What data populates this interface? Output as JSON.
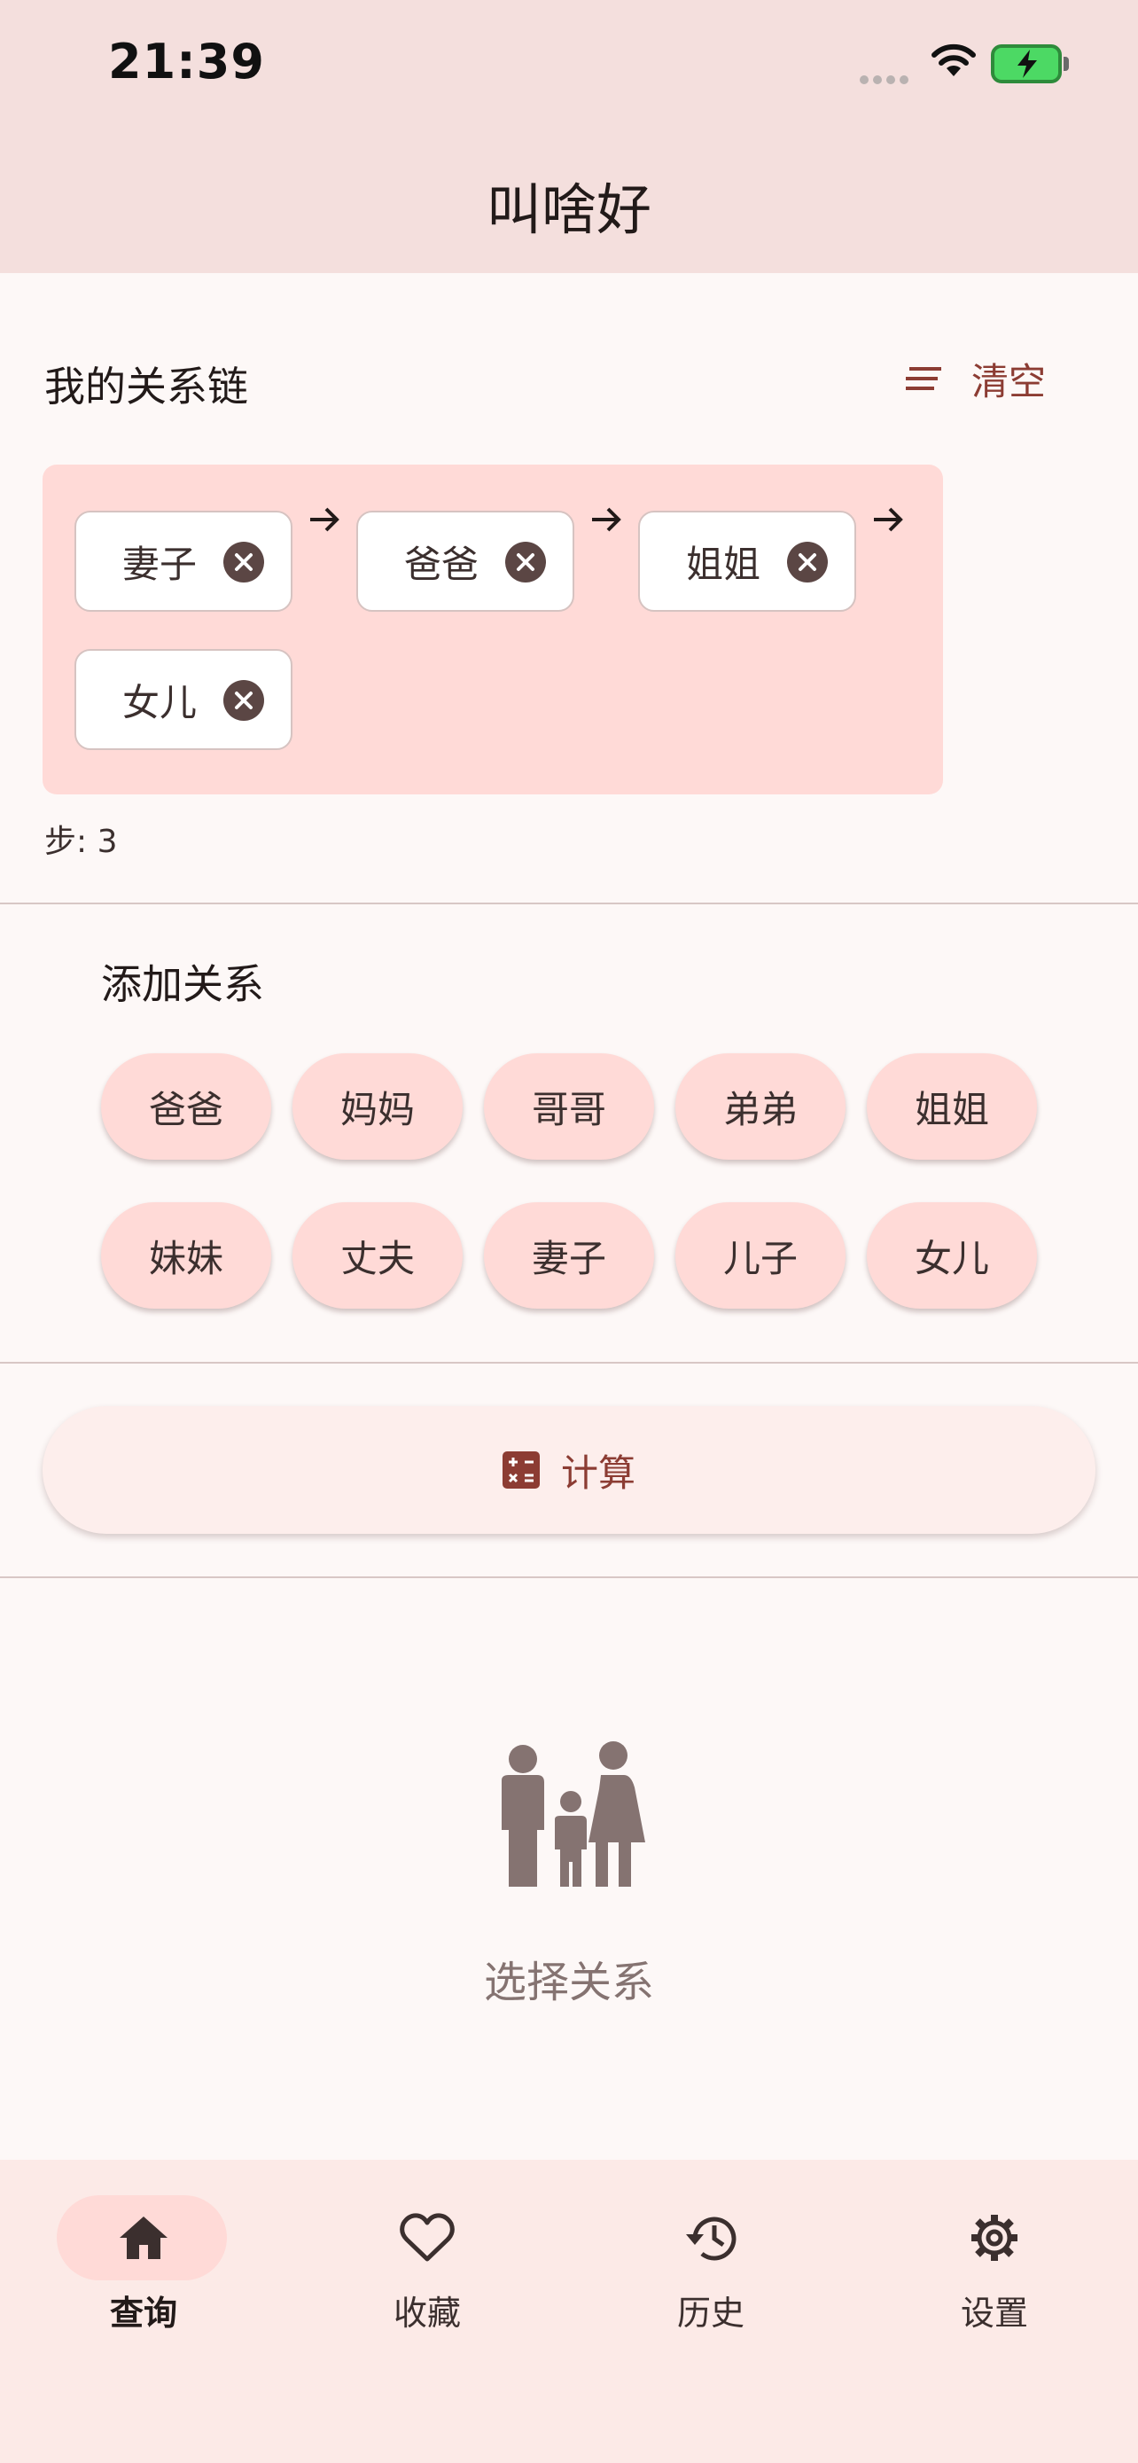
{
  "status_bar": {
    "time": "21:39"
  },
  "app_bar": {
    "title": "叫啥好"
  },
  "chain": {
    "title": "我的关系链",
    "clear_label": "清空",
    "items": [
      "妻子",
      "爸爸",
      "姐姐",
      "女儿"
    ],
    "steps_text": "步: 3"
  },
  "add_relation": {
    "title": "添加关系",
    "options": [
      "爸爸",
      "妈妈",
      "哥哥",
      "弟弟",
      "姐姐",
      "妹妹",
      "丈夫",
      "妻子",
      "儿子",
      "女儿"
    ]
  },
  "compute": {
    "label": "计算"
  },
  "empty_state": {
    "text": "选择关系"
  },
  "bottom_nav": {
    "items": [
      {
        "label": "查询",
        "icon": "home-icon",
        "active": true
      },
      {
        "label": "收藏",
        "icon": "heart-icon",
        "active": false
      },
      {
        "label": "历史",
        "icon": "history-icon",
        "active": false
      },
      {
        "label": "设置",
        "icon": "gear-icon",
        "active": false
      }
    ]
  },
  "colors": {
    "header_bg": "#f4dfdd",
    "accent": "#8c3c33",
    "chip_bg": "#ffdad7",
    "page_bg": "#fdf8f7"
  }
}
